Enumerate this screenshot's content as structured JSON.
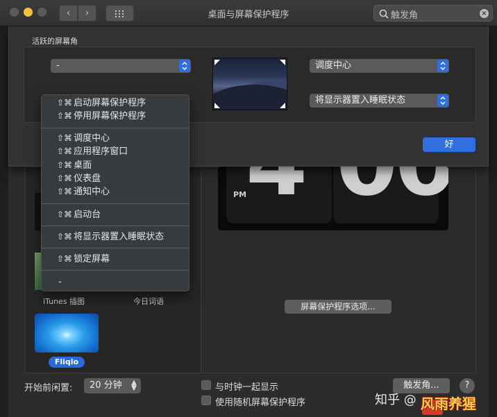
{
  "window": {
    "title": "桌面与屏幕保护程序"
  },
  "toolbar": {
    "back": "‹",
    "forward": "›"
  },
  "search": {
    "value": "触发角",
    "clear": "×"
  },
  "sheet": {
    "title": "活跃的屏幕角",
    "top_left": "-",
    "top_right": "调度中心",
    "bottom_right": "将显示器置入睡眠状态",
    "ok": "好"
  },
  "menu": {
    "items": [
      {
        "label": "启动屏幕保护程序",
        "keys": "⇧⌘"
      },
      {
        "label": "停用屏幕保护程序",
        "keys": "⇧⌘"
      },
      {
        "label": "调度中心",
        "keys": "⇧⌘"
      },
      {
        "label": "应用程序窗口",
        "keys": "⇧⌘"
      },
      {
        "label": "桌面",
        "keys": "⇧⌘"
      },
      {
        "label": "仪表盘",
        "keys": "⇧⌘"
      },
      {
        "label": "通知中心",
        "keys": "⇧⌘"
      },
      {
        "label": "启动台",
        "keys": "⇧⌘"
      },
      {
        "label": "将显示器置入睡眠状态",
        "keys": "⇧⌘"
      },
      {
        "label": "锁定屏幕",
        "keys": "⇧⌘"
      },
      {
        "label": "-",
        "keys": ""
      }
    ]
  },
  "screensavers": {
    "itunes": "iTunes 插图",
    "word_of_day": "今日词语",
    "fliqlo": "Fliqlo"
  },
  "clock": {
    "hour": "4",
    "minutes": "00",
    "ampm": "PM"
  },
  "options_button": "屏幕保护程序选项...",
  "bottom": {
    "idle_label": "开始前闲置:",
    "idle_value": "20 分钟",
    "show_clock": "与时钟一起显示",
    "random": "使用随机屏幕保护程序",
    "hot_corners": "触发角...",
    "help": "?"
  },
  "watermark": {
    "left": "知乎 @",
    "right": "风雨养猩"
  },
  "colors": {
    "accent": "#2f6fe0",
    "menu_bg": "#383c40"
  }
}
